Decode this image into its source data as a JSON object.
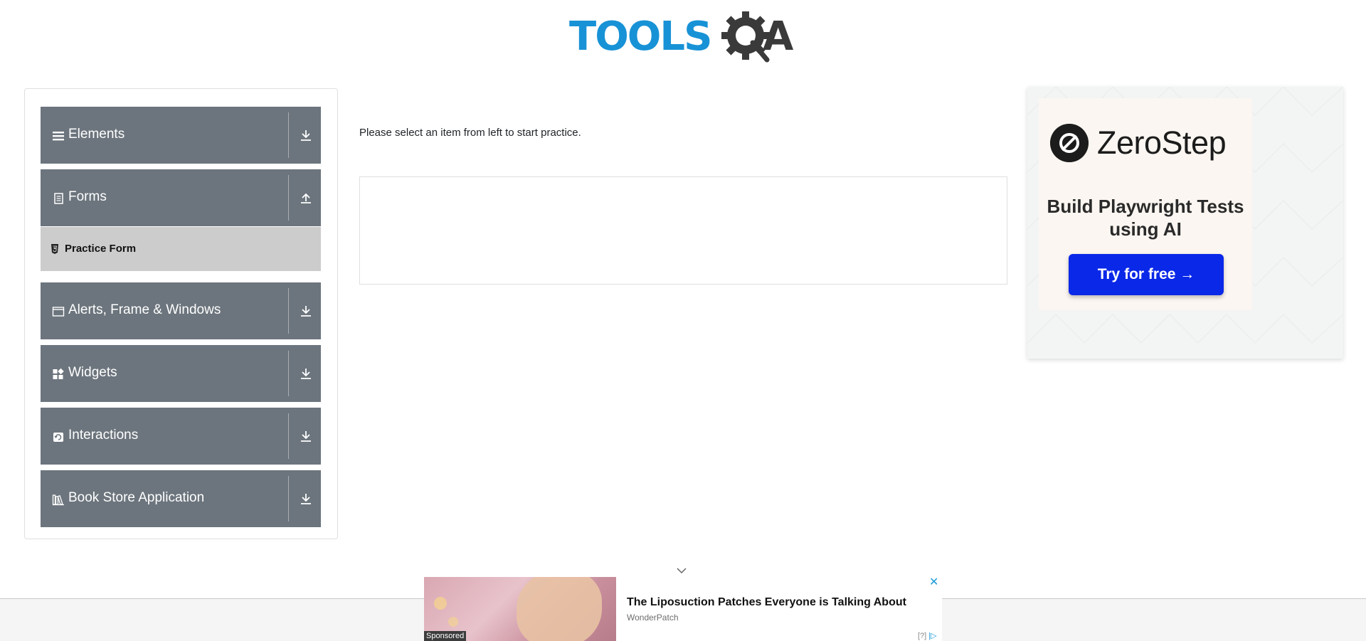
{
  "header": {
    "logo_text_blue": "TOOLS",
    "logo_text_dark": "A",
    "logo_alt": "TOOLSQA"
  },
  "sidebar": {
    "groups": [
      {
        "label": "Elements",
        "icon": "hamburger-icon",
        "arrow": "download-arrow-icon"
      },
      {
        "label": "Forms",
        "icon": "document-icon",
        "arrow": "upload-arrow-icon"
      },
      {
        "label": "Alerts, Frame & Windows",
        "icon": "window-icon",
        "arrow": "download-arrow-icon"
      },
      {
        "label": "Widgets",
        "icon": "widgets-icon",
        "arrow": "download-arrow-icon"
      },
      {
        "label": "Interactions",
        "icon": "interactions-icon",
        "arrow": "download-arrow-icon"
      },
      {
        "label": "Book Store Application",
        "icon": "books-icon",
        "arrow": "download-arrow-icon"
      }
    ],
    "forms_subitems": [
      {
        "label": "Practice Form",
        "icon": "html5-icon"
      }
    ]
  },
  "main": {
    "prompt": "Please select an item from left to start practice."
  },
  "ad": {
    "brand": "ZeroStep",
    "tagline": "Build Playwright Tests using AI",
    "cta": "Try for free →"
  },
  "bottom_ad": {
    "title": "The Liposuction Patches Everyone is Talking About",
    "brand": "WonderPatch",
    "sponsored": "Sponsored",
    "close": "✕",
    "info": "[?]"
  },
  "colors": {
    "sidebar_group": "#6c757d",
    "sidebar_subitem": "#cccccc",
    "logo_blue": "#1892d6",
    "cta_blue": "#0a28e8"
  }
}
